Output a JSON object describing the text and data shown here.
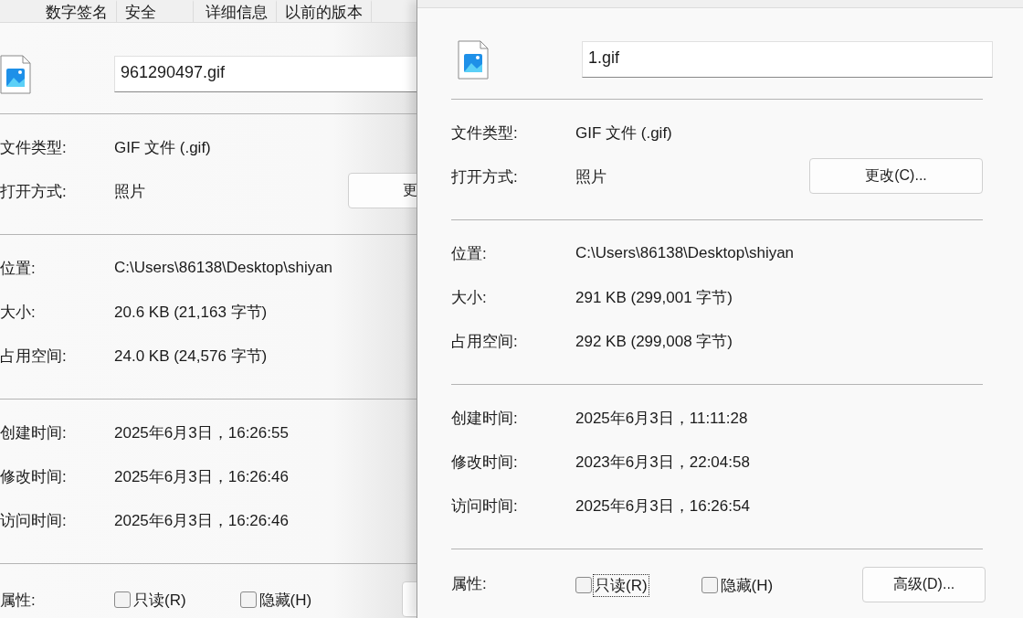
{
  "windows": [
    {
      "tabs": [
        {
          "label": "数字签名",
          "selected": false
        },
        {
          "label": "安全",
          "selected": false
        },
        {
          "label": "详细信息",
          "selected": false
        },
        {
          "label": "以前的版本",
          "selected": false
        }
      ],
      "file_name": "961290497.gif",
      "sections": [
        [
          {
            "label": "文件类型:",
            "value": "GIF 文件 (.gif)"
          },
          {
            "label": "打开方式:",
            "value": "照片",
            "button": "更"
          }
        ],
        [
          {
            "label": "位置:",
            "value": "C:\\Users\\86138\\Desktop\\shiyan"
          },
          {
            "label": "大小:",
            "value": "20.6 KB (21,163 字节)"
          },
          {
            "label": "占用空间:",
            "value": "24.0 KB (24,576 字节)"
          }
        ],
        [
          {
            "label": "创建时间:",
            "value": "2025年6月3日，16:26:55"
          },
          {
            "label": "修改时间:",
            "value": "2025年6月3日，16:26:46"
          },
          {
            "label": "访问时间:",
            "value": "2025年6月3日，16:26:46"
          }
        ]
      ],
      "attributes": {
        "label": "属性:",
        "checkboxes": [
          {
            "label": "只读(R)",
            "checked": false,
            "focused": false
          },
          {
            "label": "隐藏(H)",
            "checked": false,
            "focused": false
          }
        ]
      }
    },
    {
      "file_name": "1.gif",
      "sections": [
        [
          {
            "label": "文件类型:",
            "value": "GIF 文件 (.gif)"
          },
          {
            "label": "打开方式:",
            "value": "照片",
            "button": "更改(C)..."
          }
        ],
        [
          {
            "label": "位置:",
            "value": "C:\\Users\\86138\\Desktop\\shiyan"
          },
          {
            "label": "大小:",
            "value": "291 KB (299,001 字节)"
          },
          {
            "label": "占用空间:",
            "value": "292 KB (299,008 字节)"
          }
        ],
        [
          {
            "label": "创建时间:",
            "value": "2025年6月3日，11:11:28"
          },
          {
            "label": "修改时间:",
            "value": "2023年6月3日，22:04:58"
          },
          {
            "label": "访问时间:",
            "value": "2025年6月3日，16:26:54"
          }
        ]
      ],
      "attributes": {
        "label": "属性:",
        "checkboxes": [
          {
            "label": "只读(R)",
            "checked": false,
            "focused": true
          },
          {
            "label": "隐藏(H)",
            "checked": false,
            "focused": false
          }
        ],
        "button": "高级(D)..."
      }
    }
  ]
}
